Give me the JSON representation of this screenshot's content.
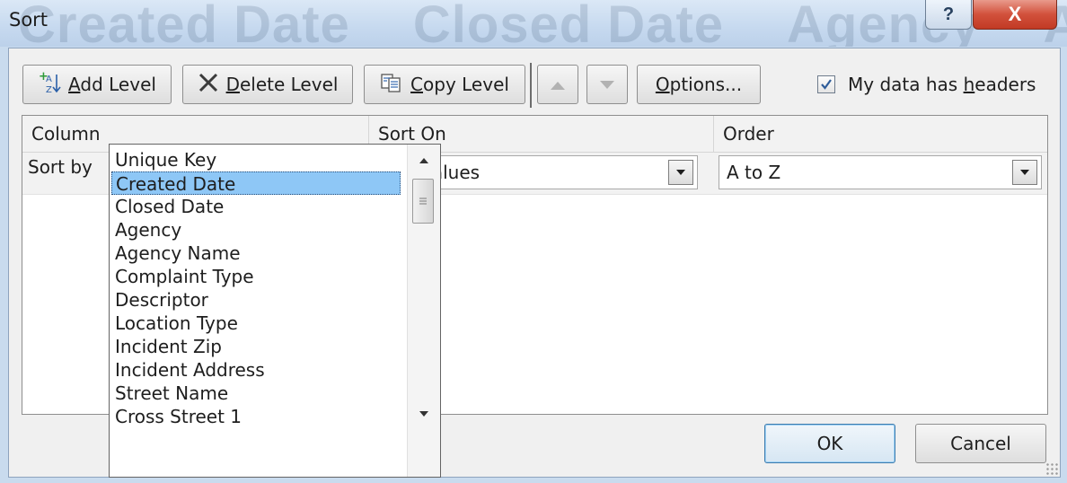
{
  "window": {
    "title": "Sort",
    "background_headers": [
      "Created Date",
      "Closed Date",
      "Agency",
      "Agency Name"
    ],
    "help_label": "?",
    "close_label": "X"
  },
  "toolbar": {
    "add_level": {
      "accel": "A",
      "rest": "dd Level"
    },
    "delete_level": {
      "accel": "D",
      "rest": "elete Level"
    },
    "copy_level": {
      "accel": "C",
      "rest": "opy Level"
    },
    "move_up_icon": "triangle-up",
    "move_down_icon": "triangle-down",
    "options": {
      "accel": "O",
      "rest": "ptions..."
    },
    "headers_checkbox": {
      "pre": "My data has ",
      "accel": "h",
      "post": "eaders",
      "checked": true
    }
  },
  "grid": {
    "headers": {
      "column": "Column",
      "sort_on": "Sort On",
      "order": "Order"
    },
    "row": {
      "label": "Sort by",
      "column_value": "",
      "sort_on_value": "Cell Values",
      "order_value": "A to Z"
    }
  },
  "dropdown": {
    "items": [
      "Unique Key",
      "Created Date",
      "Closed Date",
      "Agency",
      "Agency Name",
      "Complaint Type",
      "Descriptor",
      "Location Type",
      "Incident Zip",
      "Incident Address",
      "Street Name",
      "Cross Street 1"
    ],
    "selected_index": 1
  },
  "footer": {
    "ok_label": "OK",
    "cancel_label": "Cancel"
  },
  "colors": {
    "selection": "#8ec7f6",
    "close_button": "#c23a24",
    "title_bar": "#c6d9ef"
  }
}
